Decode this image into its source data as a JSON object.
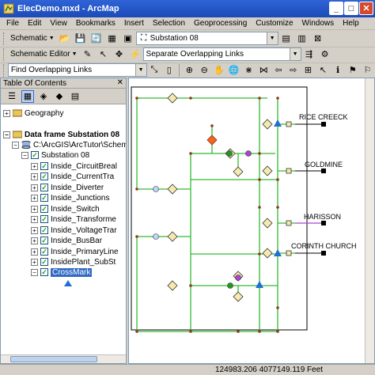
{
  "window": {
    "title": "ElecDemo.mxd - ArcMap",
    "minimize": "_",
    "maximize": "□",
    "close": "✕"
  },
  "menu": [
    "File",
    "Edit",
    "View",
    "Bookmarks",
    "Insert",
    "Selection",
    "Geoprocessing",
    "Customize",
    "Windows",
    "Help"
  ],
  "toolbar1": {
    "schematic_label": "Schematic",
    "diagram_value": "Substation 08"
  },
  "toolbar2": {
    "schematic_editor_label": "Schematic Editor",
    "layout_value": "Separate Overlapping Links"
  },
  "toolbar3": {
    "task_value": "Find Overlapping Links"
  },
  "toc": {
    "title": "Table Of Contents",
    "close": "✕",
    "items": [
      {
        "label": "Geography"
      },
      {
        "label": "Data frame Substation 08"
      },
      {
        "label": "C:\\ArcGIS\\ArcTutor\\Schem"
      },
      {
        "label": "Substation 08"
      },
      {
        "label": "Inside_CircuitBreal"
      },
      {
        "label": "Inside_CurrentTra"
      },
      {
        "label": "Inside_Diverter"
      },
      {
        "label": "Inside_Junctions"
      },
      {
        "label": "Inside_Switch"
      },
      {
        "label": "Inside_Transforme"
      },
      {
        "label": "Inside_VoltageTrar"
      },
      {
        "label": "Inside_BusBar"
      },
      {
        "label": "Inside_PrimaryLine"
      },
      {
        "label": "InsidePlant_SubSt"
      },
      {
        "label": "CrossMark"
      }
    ]
  },
  "map": {
    "labels": [
      "RICE CREECK",
      "GOLDMINE",
      "HARISSON",
      "CORINTH CHURCH"
    ],
    "colors": {
      "line_green": "#33bb33",
      "line_purple": "#aa44cc",
      "node_brown": "#8b3a1a",
      "diamond_fill": "#f5e9b0",
      "triangle_blue": "#1f6fd0",
      "feeder_square": "#000000"
    }
  },
  "status": {
    "coords": "124983.206  4077149.119 Feet"
  }
}
